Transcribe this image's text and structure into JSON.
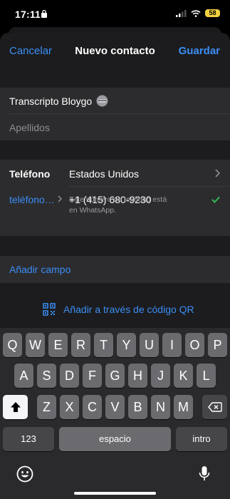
{
  "status_bar": {
    "time": "17:11",
    "battery": "58"
  },
  "nav": {
    "cancel": "Cancelar",
    "title": "Nuevo contacto",
    "save": "Guardar"
  },
  "name": {
    "first": "Transcripto Bloygo",
    "last_placeholder": "Apellidos"
  },
  "phone": {
    "section_label": "Teléfono",
    "country": "Estados Unidos",
    "type_label": "teléfono…",
    "number": "+1  (415) 680-9230",
    "note_line1": "Este número de teléfono está",
    "note_line2": "en WhatsApp."
  },
  "add_field": "Añadir campo",
  "qr": "Añadir a través de código QR",
  "keyboard": {
    "row1": [
      "Q",
      "W",
      "E",
      "R",
      "T",
      "Y",
      "U",
      "I",
      "O",
      "P"
    ],
    "row2": [
      "A",
      "S",
      "D",
      "F",
      "G",
      "H",
      "J",
      "K",
      "L"
    ],
    "row3": [
      "Z",
      "X",
      "C",
      "V",
      "B",
      "N",
      "M"
    ],
    "numbers_key": "123",
    "space_key": "espacio",
    "return_key": "intro"
  },
  "colors": {
    "accent": "#3b8ef5",
    "check": "#34c759",
    "battery": "#f3d03e"
  }
}
